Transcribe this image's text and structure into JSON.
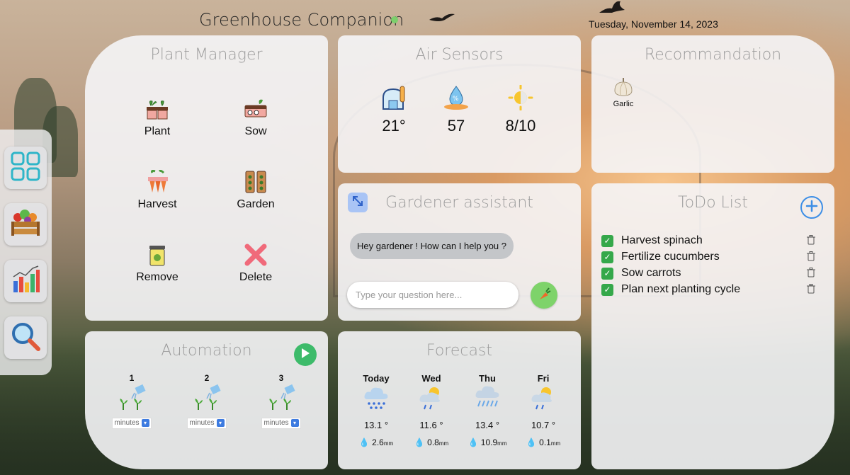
{
  "header": {
    "title": "Greenhouse Companion",
    "date": "Tuesday, November 14, 2023"
  },
  "sidebar": {
    "items": [
      {
        "name": "dashboard",
        "icon": "grid-icon"
      },
      {
        "name": "crates",
        "icon": "vegetable-crate-icon"
      },
      {
        "name": "stats",
        "icon": "bar-chart-icon"
      },
      {
        "name": "search",
        "icon": "magnifier-icon"
      }
    ]
  },
  "plant_manager": {
    "title": "Plant Manager",
    "actions": [
      {
        "label": "Plant",
        "icon": "seedling-pots-icon"
      },
      {
        "label": "Sow",
        "icon": "seed-tray-icon"
      },
      {
        "label": "Harvest",
        "icon": "carrots-icon"
      },
      {
        "label": "Garden",
        "icon": "seed-packets-icon"
      },
      {
        "label": "Remove",
        "icon": "compost-bin-icon"
      },
      {
        "label": "Delete",
        "icon": "cross-icon"
      }
    ]
  },
  "air_sensors": {
    "title": "Air Sensors",
    "readings": [
      {
        "value": "21°",
        "icon": "greenhouse-thermometer-icon"
      },
      {
        "value": "57",
        "icon": "humidity-icon"
      },
      {
        "value": "8/10",
        "icon": "sun-light-icon"
      }
    ]
  },
  "recommendation": {
    "title": "Recommandation",
    "items": [
      {
        "label": "Garlic",
        "icon": "garlic-icon"
      }
    ]
  },
  "assistant": {
    "title": "Gardener assistant",
    "greeting": "Hey gardener ! How can I help you ?",
    "placeholder": "Type your question here..."
  },
  "todo": {
    "title": "ToDo List",
    "items": [
      {
        "label": "Harvest spinach",
        "done": true
      },
      {
        "label": "Fertilize cucumbers",
        "done": true
      },
      {
        "label": "Sow carrots",
        "done": true
      },
      {
        "label": "Plan next planting cycle",
        "done": true
      }
    ]
  },
  "automation": {
    "title": "Automation",
    "zones": [
      {
        "number": "1",
        "unit": "minutes"
      },
      {
        "number": "2",
        "unit": "minutes"
      },
      {
        "number": "3",
        "unit": "minutes"
      }
    ]
  },
  "forecast": {
    "title": "Forecast",
    "days": [
      {
        "day": "Today",
        "temp": "13.1 °",
        "rain": "2.6",
        "unit": "mm",
        "icon": "rain-cloud-icon"
      },
      {
        "day": "Wed",
        "temp": "11.6 °",
        "rain": "0.8",
        "unit": "mm",
        "icon": "sun-rain-icon"
      },
      {
        "day": "Thu",
        "temp": "13.4 °",
        "rain": "10.9",
        "unit": "mm",
        "icon": "heavy-rain-icon"
      },
      {
        "day": "Fri",
        "temp": "10.7 °",
        "rain": "0.1",
        "unit": "mm",
        "icon": "sun-rain-icon"
      }
    ]
  },
  "colors": {
    "accent_green": "#35a84a",
    "accent_blue": "#3d8ee6",
    "card_bg": "#f5f5f7"
  }
}
